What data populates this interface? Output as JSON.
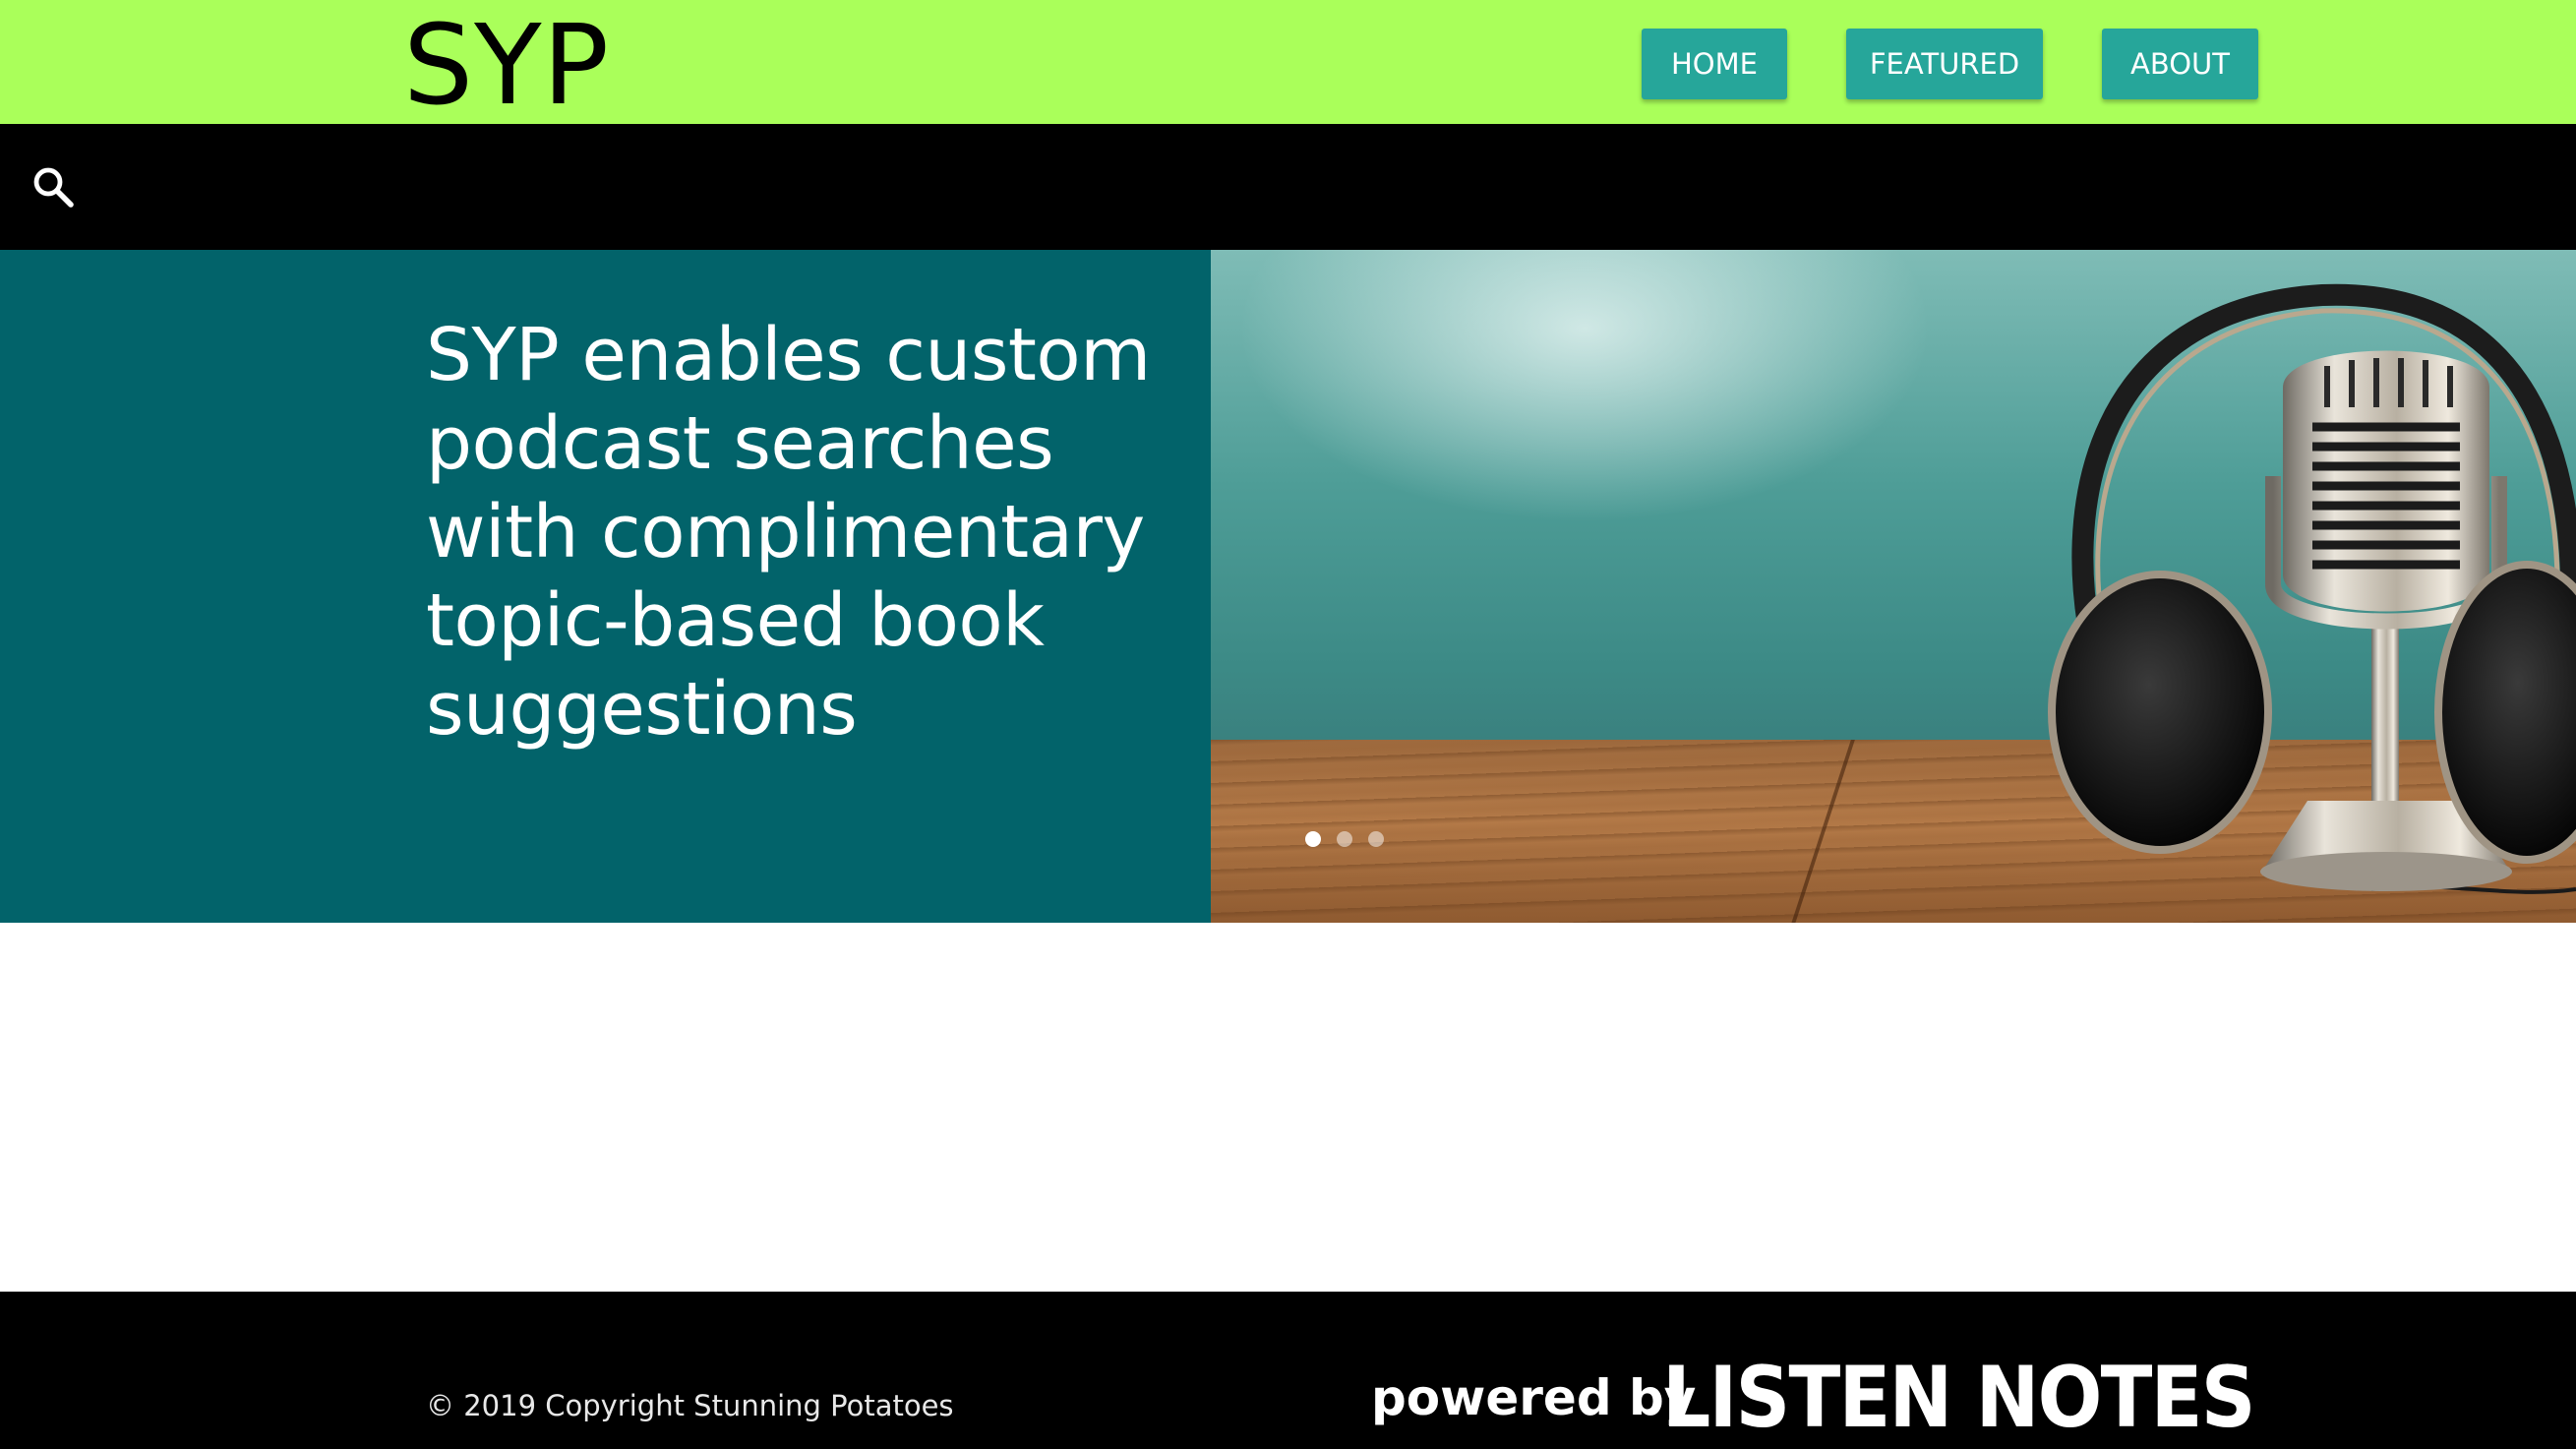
{
  "header": {
    "brand": "SYP",
    "nav": [
      {
        "label": "HOME"
      },
      {
        "label": "FEATURED"
      },
      {
        "label": "ABOUT"
      }
    ],
    "bg_color": "#aaff5a",
    "button_color": "#26a69a"
  },
  "search": {
    "icon": "search-icon",
    "placeholder": ""
  },
  "hero": {
    "headline": "SYP enables custom podcast searches with complimentary topic-based book suggestions",
    "bg_color": "#02636a",
    "image": "microphone-with-headphones-on-wooden-table",
    "carousel": {
      "slides": 3,
      "active_index": 0
    }
  },
  "footer": {
    "copyright": "© 2019 Copyright Stunning Potatoes",
    "powered_by": "powered by",
    "logo_text": "LISTEN NOTES"
  }
}
